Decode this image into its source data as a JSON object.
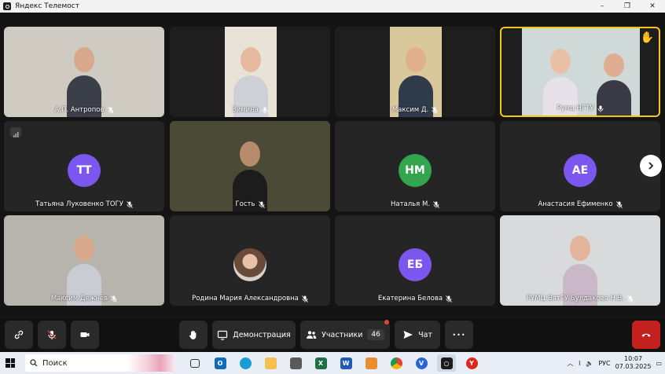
{
  "window": {
    "title": "Яндекс Телемост",
    "controls": [
      "–",
      "❐",
      "✕"
    ]
  },
  "participants": [
    {
      "name": "А.П. Антропов",
      "muted": true,
      "video": true,
      "speaking": false,
      "bg": "#cfcac2",
      "skin": "#d8a88a",
      "shirt": "#3b3f4a"
    },
    {
      "name": "Зимина",
      "muted": false,
      "video": true,
      "speaking": false,
      "bg": "#e8e3d6",
      "skin": "#e7b9a0",
      "shirt": "#cdd0d6"
    },
    {
      "name": "Максим Д.",
      "muted": true,
      "video": true,
      "speaking": false,
      "bg": "#d9c89c",
      "skin": "#e0b08e",
      "shirt": "#2f3a4a"
    },
    {
      "name": "Румц НГТУ",
      "muted": false,
      "video": true,
      "speaking": true,
      "bg": "#cfd9d8",
      "skin": "#e9c0a4",
      "shirt": "#e7e2ea"
    },
    {
      "name": "Татьяна Луковенко ТОГУ",
      "muted": true,
      "video": false,
      "initials": "ТТ",
      "avatar_color": "#7b57f0"
    },
    {
      "name": "Гость",
      "muted": true,
      "video": true,
      "speaking": false,
      "bg": "#4a4a36",
      "skin": "#b58b6c",
      "shirt": "#1c1c1c"
    },
    {
      "name": "Наталья М.",
      "muted": true,
      "video": false,
      "initials": "НМ",
      "avatar_color": "#33a64d"
    },
    {
      "name": "Анастасия Ефименко",
      "muted": true,
      "video": false,
      "initials": "АЕ",
      "avatar_color": "#7b57f0"
    },
    {
      "name": "Максим Дежнёв",
      "muted": true,
      "video": true,
      "speaking": false,
      "bg": "#b7b3ad",
      "skin": "#d9a88a",
      "shirt": "#c9ccd3"
    },
    {
      "name": "Родина Мария Александровна",
      "muted": true,
      "video": false,
      "photo_avatar": true
    },
    {
      "name": "Екатерина Белова",
      "muted": true,
      "video": false,
      "initials": "ЕБ",
      "avatar_color": "#7b57f0"
    },
    {
      "name": "РУМЦ ВятГУ Булдакова Н.В.",
      "muted": true,
      "video": true,
      "speaking": false,
      "bg": "#d9dadc",
      "skin": "#e3b49a",
      "shirt": "#c9b8c8"
    }
  ],
  "controls": {
    "demo_label": "Демонстрация",
    "participants_label": "Участники",
    "participants_count": "46",
    "chat_label": "Чат",
    "more_label": "•••"
  },
  "taskbar": {
    "search_label": "Поиск",
    "lang": "РУС",
    "time": "10:07",
    "date": "07.03.2025"
  },
  "colors": {
    "accent_speaking": "#f5c518",
    "end_call": "#c3201e",
    "avatar_purple": "#7b57f0",
    "avatar_green": "#33a64d"
  }
}
